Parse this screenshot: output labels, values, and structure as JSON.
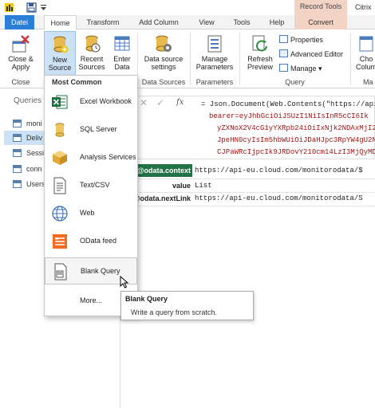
{
  "titlebar": {
    "context_tab_group": "Record Tools",
    "app_title": "Citrix"
  },
  "tabs": [
    "Datei",
    "Home",
    "Transform",
    "Add Column",
    "View",
    "Tools",
    "Help",
    "Convert"
  ],
  "ribbon": {
    "close_apply": [
      "Close &",
      "Apply"
    ],
    "new_source": [
      "New",
      "Source"
    ],
    "recent_sources": [
      "Recent",
      "Sources"
    ],
    "enter_data": [
      "Enter",
      "Data"
    ],
    "data_source_settings": [
      "Data source",
      "settings"
    ],
    "manage_parameters": [
      "Manage",
      "Parameters"
    ],
    "refresh_preview": [
      "Refresh",
      "Preview"
    ],
    "properties": "Properties",
    "advanced_editor": "Advanced Editor",
    "manage": "Manage",
    "choose_columns": [
      "Cho",
      "Colum"
    ],
    "groups": {
      "close": "Close",
      "data_sources": "Data Sources",
      "parameters": "Parameters",
      "query": "Query",
      "manage_cut": "Ma"
    }
  },
  "queries": {
    "title": "Queries",
    "items": [
      "moni",
      "Deliv",
      "Sessi",
      "conn",
      "Users"
    ],
    "selected_index": 1
  },
  "formula": {
    "fx": "fx",
    "lines": [
      "= Json.Document(Web.Contents(\"https://api",
      "bearer=eyJhbGciOiJSUzI1NiIsInR5cCI6Ik",
      "yZXNoX2V4cG1yYXRpb24iOiIxNjk2NDAxMjI2",
      "JpeHN0cyIsIm5hbWUiOiJDaHJpc3RpYW4gU2N",
      "CJPaWRcIjpcIk9JRDovY210cm14LzI3MjQyMD"
    ]
  },
  "record": [
    {
      "label": "@odata.context",
      "value": "https://api-eu.cloud.com/monitorodata/$"
    },
    {
      "label": "value",
      "value": "List"
    },
    {
      "label": "@odata.nextLink",
      "value": "https://api-eu.cloud.com/monitorodata/S"
    }
  ],
  "new_source_menu": {
    "header": "Most Common",
    "items": [
      "Excel Workbook",
      "SQL Server",
      "Analysis Services",
      "Text/CSV",
      "Web",
      "OData feed",
      "Blank Query",
      "More..."
    ],
    "hovered_index": 6
  },
  "tooltip": {
    "title": "Blank Query",
    "description": "Write a query from scratch."
  },
  "colors": {
    "file_tab": "#2b7ed7",
    "context_tab": "#f3d3c4",
    "selected_query": "#cde1f4",
    "excel_green": "#1e7145",
    "odata_orange": "#f26b21",
    "code_red": "#a31515"
  }
}
